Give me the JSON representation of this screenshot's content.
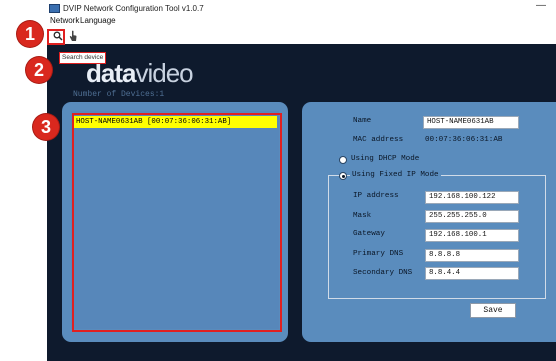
{
  "window": {
    "title": "DVIP Network Configuration Tool v1.0.7",
    "minimize_label": "—"
  },
  "menu": {
    "items": [
      "Network",
      "Language"
    ]
  },
  "toolbar": {
    "search_icon": "search-icon",
    "hand_icon": "hand-pointer-icon",
    "tooltip": "Search device"
  },
  "brand": {
    "logo_part1": "data",
    "logo_part2": "video"
  },
  "devices": {
    "count_label": "Number of Devices:1",
    "list": [
      "HOST-NAME0631AB [00:07:36:06:31:AB]"
    ]
  },
  "details": {
    "name_label": "Name",
    "name_value": "HOST-NAME0631AB",
    "mac_label": "MAC address",
    "mac_value": "00:07:36:06:31:AB",
    "dhcp_label": "Using DHCP Mode",
    "fixed_label": "Using Fixed IP Mode",
    "ip_label": "IP address",
    "ip_value": "192.168.100.122",
    "mask_label": "Mask",
    "mask_value": "255.255.255.0",
    "gateway_label": "Gateway",
    "gateway_value": "192.168.100.1",
    "primary_dns_label": "Primary DNS",
    "primary_dns_value": "8.8.8.8",
    "secondary_dns_label": "Secondary DNS",
    "secondary_dns_value": "8.8.4.4",
    "save_label": "Save"
  },
  "annotations": {
    "badge1": "1",
    "badge2": "2",
    "badge3": "3"
  },
  "colors": {
    "panel": "#5a8cbd",
    "background": "#0e1a2d",
    "selection": "#ffff00",
    "annotation_red": "#e02020"
  }
}
